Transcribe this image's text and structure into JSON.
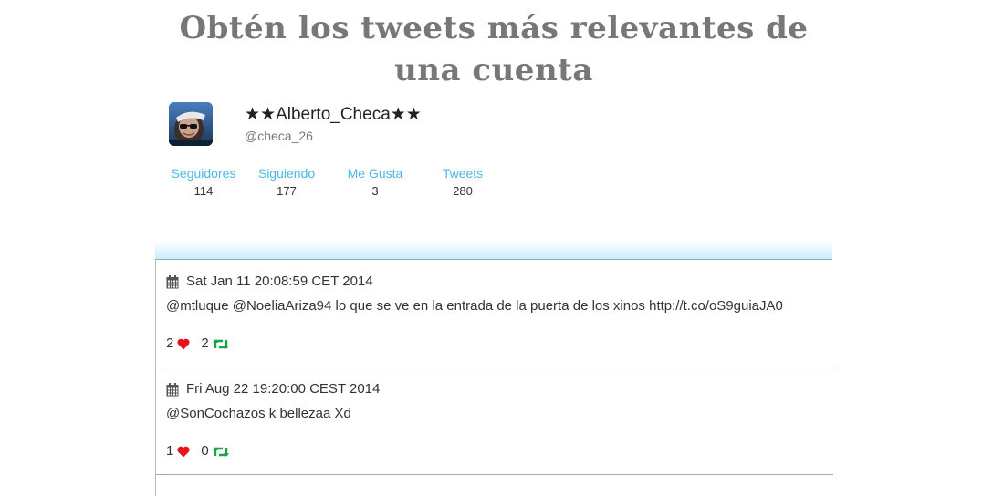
{
  "page": {
    "title": "Obtén los tweets más relevantes de una cuenta"
  },
  "profile": {
    "display_name": "★★Alberto_Checa★★",
    "handle": "@checa_26",
    "stats": [
      {
        "label": "Seguidores",
        "value": "114"
      },
      {
        "label": "Siguiendo",
        "value": "177"
      },
      {
        "label": "Me Gusta",
        "value": "3"
      },
      {
        "label": "Tweets",
        "value": "280"
      }
    ]
  },
  "tweets": [
    {
      "date": "Sat Jan 11 20:08:59 CET 2014",
      "text": "@mtluque @NoeliaAriza94 lo que se ve en la entrada de la puerta de los xinos http://t.co/oS9guiaJA0",
      "likes": "2",
      "retweets": "2"
    },
    {
      "date": "Fri Aug 22 19:20:00 CEST 2014",
      "text": "@SonCochazos k bellezaa Xd",
      "likes": "1",
      "retweets": "0"
    }
  ],
  "icons": {
    "date": "calendar-icon",
    "like": "heart-icon",
    "retweet": "retweet-icon"
  },
  "colors": {
    "link": "#4bb8e8",
    "heart": "#e8141c",
    "retweet": "#1aa348",
    "title": "#777777"
  }
}
